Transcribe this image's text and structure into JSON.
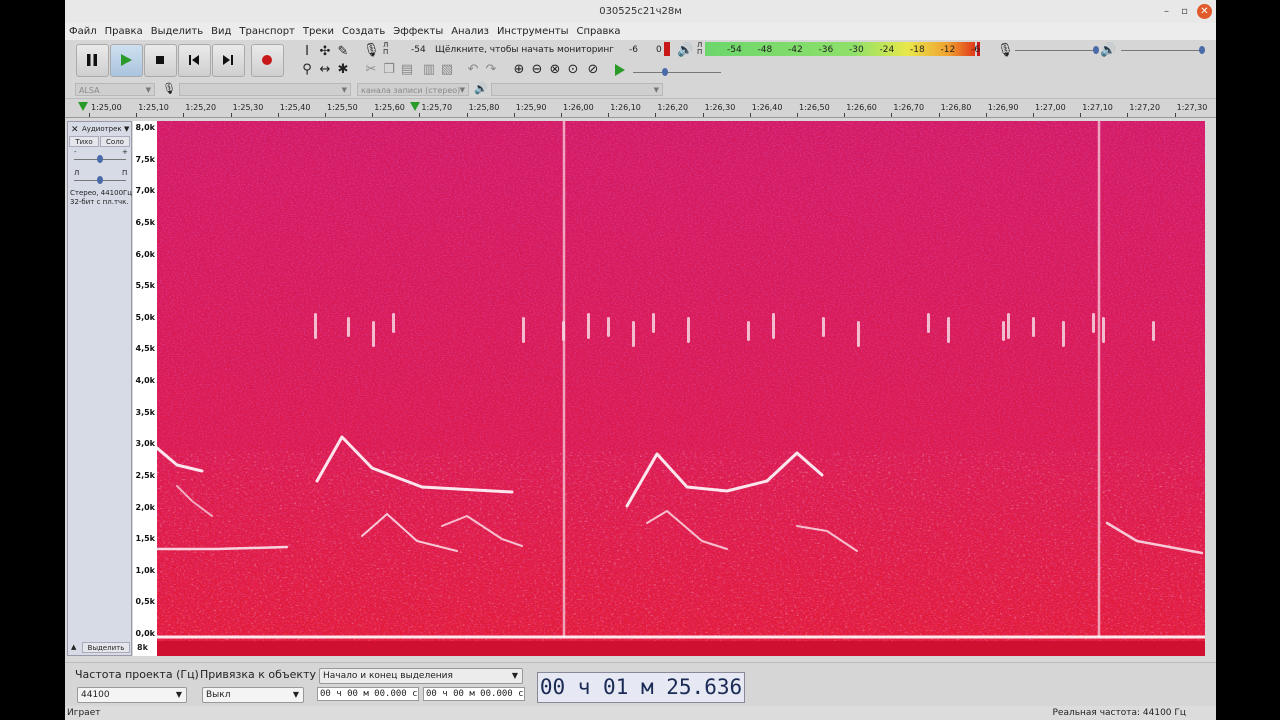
{
  "window": {
    "title": "030525c21ч28м"
  },
  "menu": [
    "Файл",
    "Правка",
    "Выделить",
    "Вид",
    "Транспорт",
    "Треки",
    "Создать",
    "Эффекты",
    "Анализ",
    "Инструменты",
    "Справка"
  ],
  "meters": {
    "record_lr": "Л\nП",
    "record_scale": [
      "-54"
    ],
    "record_hint": "Щёлкните, чтобы начать мониторинг",
    "record_scale_tail": [
      "-6",
      "0"
    ],
    "play_lr": "Л\nП",
    "play_scale": [
      "-54",
      "-48",
      "-42",
      "-36",
      "-30",
      "-24",
      "-18",
      "-12",
      "-6"
    ]
  },
  "device": {
    "host": "ALSA",
    "channels": "канала записи (стерео)"
  },
  "ruler": {
    "ticks": [
      "1:25,00",
      "1:25,10",
      "1:25,20",
      "1:25,30",
      "1:25,40",
      "1:25,50",
      "1:25,60",
      "1:25,70",
      "1:25,80",
      "1:25,90",
      "1:26,00",
      "1:26,10",
      "1:26,20",
      "1:26,30",
      "1:26,40",
      "1:26,50",
      "1:26,60",
      "1:26,70",
      "1:26,80",
      "1:26,90",
      "1:27,00",
      "1:27,10",
      "1:27,20",
      "1:27,30"
    ]
  },
  "track": {
    "name": "Аудиотрек",
    "mute": "Тихо",
    "solo": "Соло",
    "gain_min": "-",
    "gain_max": "+",
    "pan_left": "Л",
    "pan_right": "П",
    "info1": "Стерео, 44100Гц",
    "info2": "32-бит с пл.тчк.",
    "select_label": "Выделить",
    "freq_labels": [
      "8,0k",
      "7,5k",
      "7,0k",
      "6,5k",
      "6,0k",
      "5,5k",
      "5,0k",
      "4,5k",
      "4,0k",
      "3,5k",
      "3,0k",
      "2,5k",
      "2,0k",
      "1,5k",
      "1,0k",
      "0,5k",
      "0,0k"
    ],
    "lower_label": "8k"
  },
  "selection": {
    "rate_label": "Частота проекта (Гц)",
    "rate_value": "44100",
    "snap_label": "Привязка к объекту",
    "snap_value": "Выкл",
    "mode_value": "Начало и конец выделения",
    "start": "00 ч 00 м 00.000 с",
    "end": "00 ч 00 м 00.000 с"
  },
  "time": {
    "display": "00 ч 01 м 25.636 с"
  },
  "status": {
    "left": "Играет",
    "right": "Реальная частота: 44100 Гц"
  },
  "colors": {
    "spectrogram_bg": "#d81650",
    "accent_record": "#c81818",
    "play_green": "#2a9a2a"
  }
}
